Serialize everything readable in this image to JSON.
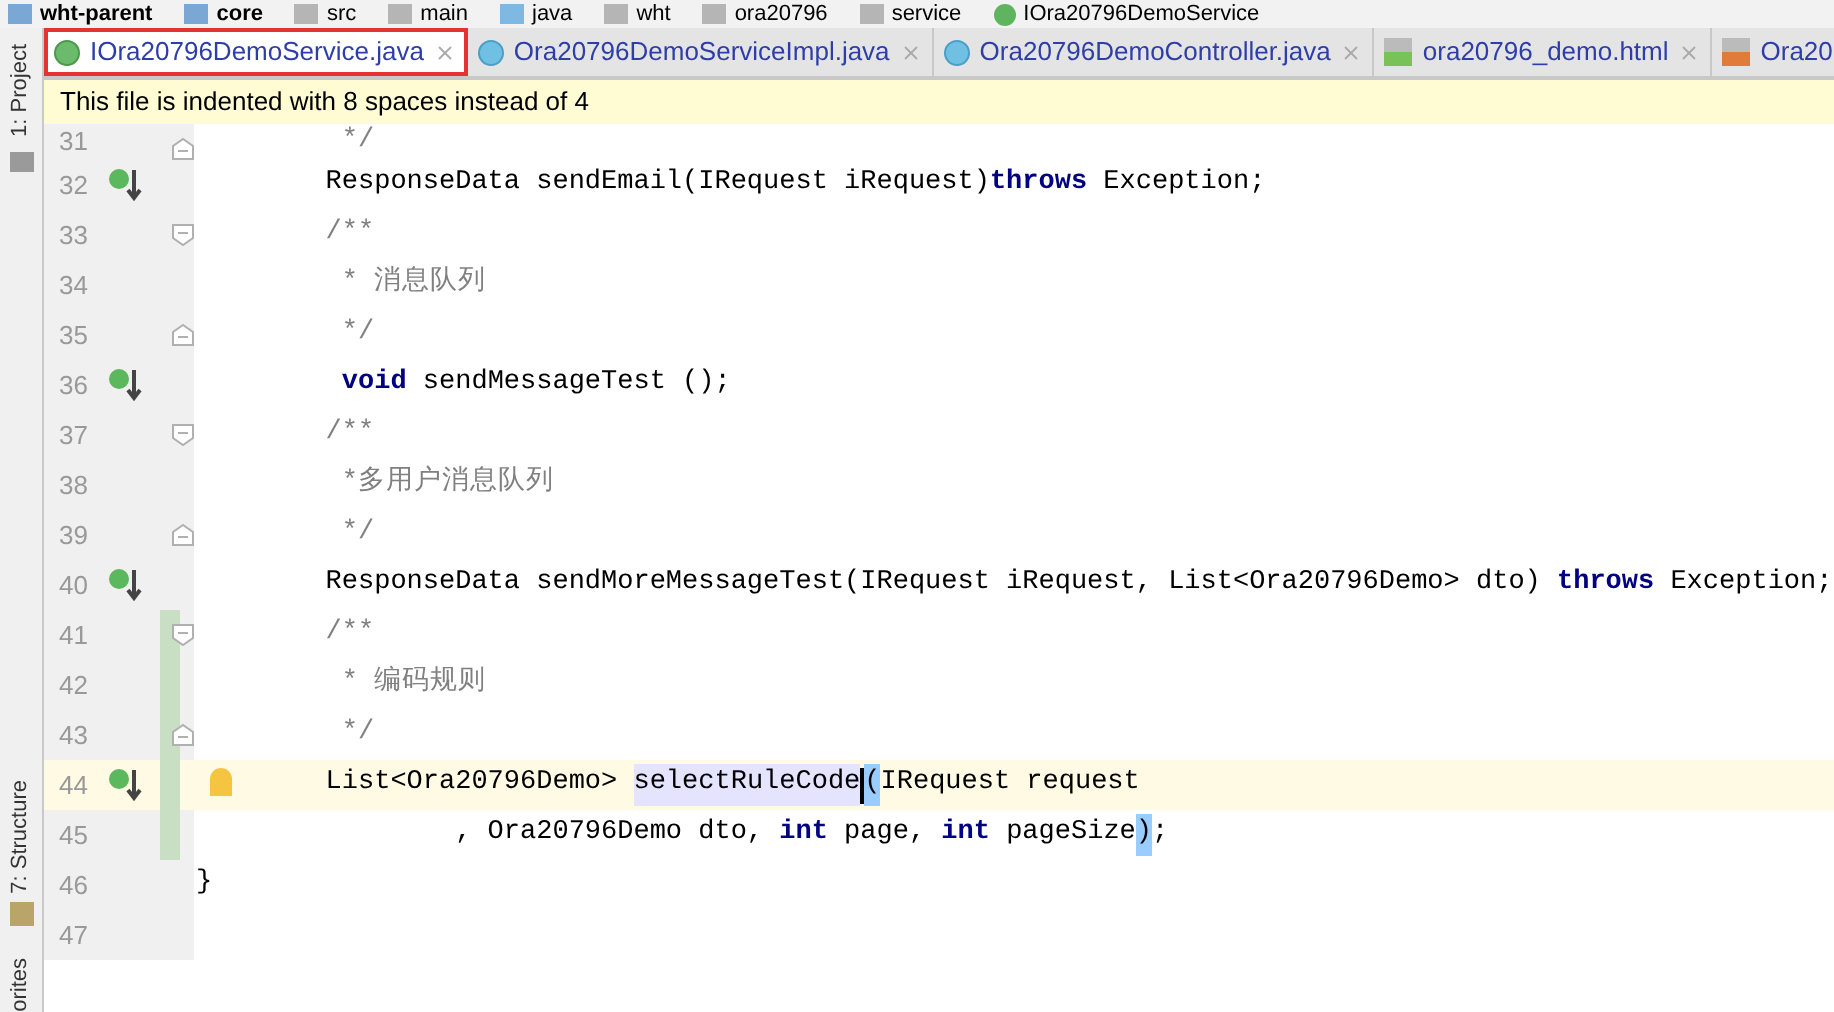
{
  "breadcrumb": [
    {
      "label": "wht-parent",
      "kind": "module"
    },
    {
      "label": "core",
      "kind": "module"
    },
    {
      "label": "src",
      "kind": "folder"
    },
    {
      "label": "main",
      "kind": "folder"
    },
    {
      "label": "java",
      "kind": "source"
    },
    {
      "label": "wht",
      "kind": "folder"
    },
    {
      "label": "ora20796",
      "kind": "folder"
    },
    {
      "label": "service",
      "kind": "folder"
    },
    {
      "label": "IOra20796DemoService",
      "kind": "interface"
    }
  ],
  "tool_strip": {
    "top": "1: Project",
    "bottom": "7: Structure",
    "cut": "orites"
  },
  "tabs": [
    {
      "label": "IOra20796DemoService.java",
      "kind": "interface",
      "selected": true,
      "highlighted": true
    },
    {
      "label": "Ora20796DemoServiceImpl.java",
      "kind": "class",
      "selected": false,
      "highlighted": false
    },
    {
      "label": "Ora20796DemoController.java",
      "kind": "class",
      "selected": false,
      "highlighted": false
    },
    {
      "label": "ora20796_demo.html",
      "kind": "html",
      "selected": false,
      "highlighted": false
    },
    {
      "label": "Ora20",
      "kind": "template",
      "selected": false,
      "highlighted": false
    }
  ],
  "notification": "This file is indented with 8 spaces instead of 4",
  "lines": [
    {
      "number": "31",
      "changed": false,
      "current": false,
      "gutter": [
        {
          "kind": "fold_end"
        }
      ],
      "tokens": [
        {
          "text": "         */",
          "kind": "comment"
        }
      ]
    },
    {
      "number": "32",
      "changed": false,
      "current": false,
      "gutter": [
        {
          "kind": "implements"
        }
      ],
      "tokens": [
        {
          "text": "        ResponseData sendEmail(IRequest iRequest)",
          "kind": "plain"
        },
        {
          "text": "throws",
          "kind": "keyword"
        },
        {
          "text": " Exception;",
          "kind": "plain"
        }
      ]
    },
    {
      "number": "33",
      "changed": false,
      "current": false,
      "gutter": [
        {
          "kind": "fold_start"
        }
      ],
      "tokens": [
        {
          "text": "        /**",
          "kind": "comment"
        }
      ]
    },
    {
      "number": "34",
      "changed": false,
      "current": false,
      "tokens": [
        {
          "text": "         * 消息队列",
          "kind": "comment"
        }
      ]
    },
    {
      "number": "35",
      "changed": false,
      "current": false,
      "gutter": [
        {
          "kind": "fold_end"
        }
      ],
      "tokens": [
        {
          "text": "         */",
          "kind": "comment"
        }
      ]
    },
    {
      "number": "36",
      "changed": false,
      "current": false,
      "gutter": [
        {
          "kind": "implements"
        }
      ],
      "tokens": [
        {
          "text": "         void",
          "kind": "keyword"
        },
        {
          "text": " sendMessageTest ();",
          "kind": "plain"
        }
      ]
    },
    {
      "number": "37",
      "changed": false,
      "current": false,
      "gutter": [
        {
          "kind": "fold_start"
        }
      ],
      "tokens": [
        {
          "text": "        /**",
          "kind": "comment"
        }
      ]
    },
    {
      "number": "38",
      "changed": false,
      "current": false,
      "tokens": [
        {
          "text": "         *多用户消息队列",
          "kind": "comment"
        }
      ]
    },
    {
      "number": "39",
      "changed": false,
      "current": false,
      "gutter": [
        {
          "kind": "fold_end"
        }
      ],
      "tokens": [
        {
          "text": "         */",
          "kind": "comment"
        }
      ]
    },
    {
      "number": "40",
      "changed": false,
      "current": false,
      "gutter": [
        {
          "kind": "implements"
        }
      ],
      "tokens": [
        {
          "text": "        ResponseData sendMoreMessageTest(IRequest iRequest, List<Ora20796Demo> dto) ",
          "kind": "plain"
        },
        {
          "text": "throws",
          "kind": "keyword"
        },
        {
          "text": " Exception;",
          "kind": "plain"
        }
      ]
    },
    {
      "number": "41",
      "changed": true,
      "current": false,
      "gutter": [
        {
          "kind": "fold_start"
        }
      ],
      "tokens": [
        {
          "text": "        /**",
          "kind": "comment"
        }
      ]
    },
    {
      "number": "42",
      "changed": true,
      "current": false,
      "tokens": [
        {
          "text": "         * 编码规则",
          "kind": "comment"
        }
      ]
    },
    {
      "number": "43",
      "changed": true,
      "current": false,
      "gutter": [
        {
          "kind": "fold_end"
        }
      ],
      "tokens": [
        {
          "text": "         */",
          "kind": "comment"
        }
      ]
    },
    {
      "number": "44",
      "changed": true,
      "current": true,
      "gutter": [
        {
          "kind": "implements"
        },
        {
          "kind": "bulb"
        }
      ],
      "tokens": [
        {
          "text": "        List<Ora20796Demo> ",
          "kind": "plain"
        },
        {
          "text": "selectRuleCode",
          "kind": "usage"
        },
        {
          "text": "(",
          "kind": "brace"
        },
        {
          "text": "IRequest request",
          "kind": "plain"
        }
      ]
    },
    {
      "number": "45",
      "changed": true,
      "current": false,
      "tokens": [
        {
          "text": "                , Ora20796Demo dto, ",
          "kind": "plain"
        },
        {
          "text": "int",
          "kind": "keyword"
        },
        {
          "text": " page, ",
          "kind": "plain"
        },
        {
          "text": "int",
          "kind": "keyword"
        },
        {
          "text": " pageSize",
          "kind": "plain"
        },
        {
          "text": ")",
          "kind": "brace"
        },
        {
          "text": ";",
          "kind": "plain"
        }
      ]
    },
    {
      "number": "46",
      "changed": false,
      "current": false,
      "tokens": [
        {
          "text": "}",
          "kind": "plain"
        }
      ]
    },
    {
      "number": "47",
      "changed": false,
      "current": false
    }
  ]
}
